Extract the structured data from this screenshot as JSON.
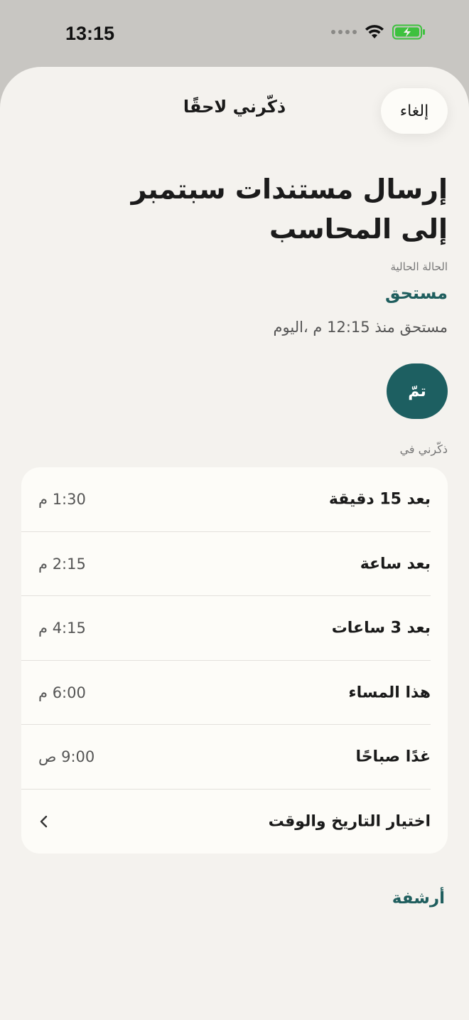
{
  "status_bar": {
    "time": "13:15"
  },
  "nav": {
    "title": "ذكّرني لاحقًا",
    "cancel": "إلغاء"
  },
  "task": {
    "title": "إرسال مستندات سبتمبر إلى المحاسب",
    "status_label": "الحالة الحالية",
    "status_value": "مستحق",
    "due_text": "مستحق منذ 12:15 م ،اليوم",
    "done_label": "تمّ"
  },
  "remind": {
    "label": "ذكّرني في",
    "options": [
      {
        "label": "بعد 15 دقيقة",
        "time": "1:30 م"
      },
      {
        "label": "بعد ساعة",
        "time": "2:15 م"
      },
      {
        "label": "بعد 3 ساعات",
        "time": "4:15 م"
      },
      {
        "label": "هذا المساء",
        "time": "6:00 م"
      },
      {
        "label": "غدًا صباحًا",
        "time": "9:00 ص"
      }
    ],
    "custom_label": "اختيار التاريخ والوقت"
  },
  "archive": "أرشفة",
  "colors": {
    "accent": "#1d5f61",
    "sheet": "#f4f2ee",
    "card": "#fdfcf8",
    "battery": "#3ec13e"
  }
}
